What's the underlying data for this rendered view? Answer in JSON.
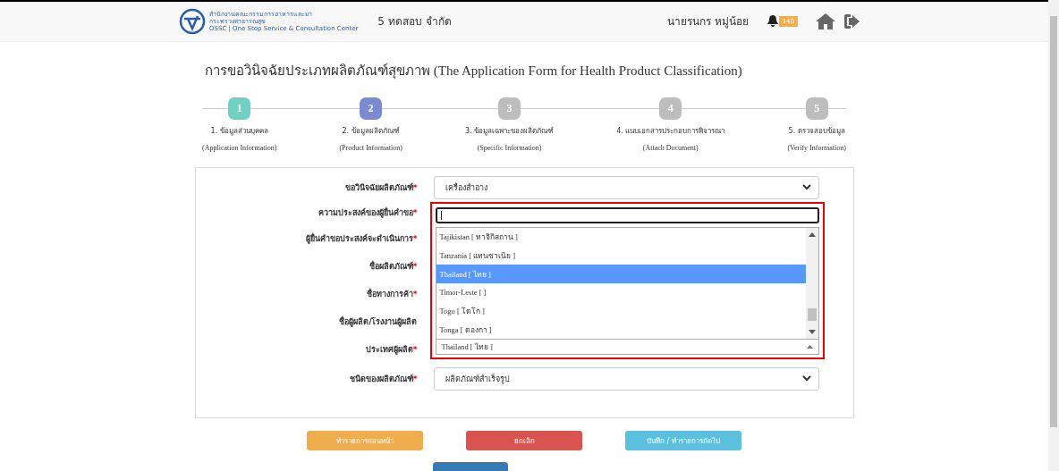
{
  "header": {
    "logo_lines": [
      "สำนักงานคณะกรรมการอาหารและยา",
      "กระทรวงสาธารณสุข",
      "OSSC | One Stop Service & Consultation Center"
    ],
    "company": "5 ทดสอบ จำกัด",
    "user": "นายรนกร หมู่น้อย",
    "notification_count": "140"
  },
  "title": {
    "thai": "การขอวินิจฉัยประเภทผลิตภัณฑ์สุขภาพ",
    "english": "(The Application Form for Health Product Classification)"
  },
  "steps": [
    {
      "number": "1",
      "label": "1. ข้อมูลส่วนบุคคล",
      "sublabel": "(Application Information)",
      "completed": true,
      "selected": false
    },
    {
      "number": "2",
      "label": "2. ข้อมูลผลิตภัณฑ์",
      "sublabel": "(Product Information)",
      "selected": true
    },
    {
      "number": "3",
      "label": "3. ข้อมูลเฉพาะของผลิตภัณฑ์",
      "sublabel": "(Specific Information)",
      "completed": false,
      "selected": false
    },
    {
      "number": "4",
      "label": "4. แนบเอกสารประกอบการพิจารณา",
      "sublabel": "(Attach Document)",
      "completed": false,
      "selected": false
    },
    {
      "number": "5",
      "label": "5. ตรวจสอบข้อมูล",
      "sublabel": "(Verify Information)",
      "completed": false,
      "selected": false
    }
  ],
  "form": {
    "fields": [
      {
        "label": "ขอวินิจฉัยผลิตภัณฑ์",
        "required_mark": "*",
        "value": "เครื่องสำอาง"
      },
      {
        "label": "ความประสงค์ของผู้ยื่นคำขอ",
        "required_mark": "*"
      },
      {
        "label": "ผู้ยื่นคำขอประสงค์จะดำเนินการ",
        "required_mark": "*"
      },
      {
        "label": "ชื่อผลิตภัณฑ์",
        "required_mark": "*"
      },
      {
        "label": "ชื่อทางการค้า",
        "required_mark": "*"
      },
      {
        "label": "ชื่อผู้ผลิต/โรงงานผู้ผลิต"
      },
      {
        "label": "ประเทศผู้ผลิต",
        "required_mark": "*",
        "value": "Thailand [ ไทย ]"
      },
      {
        "label": "ชนิดของผลิตภัณฑ์",
        "required_mark": "*",
        "value": "ผลิตภัณฑ์สำเร็จรูป"
      }
    ],
    "dropdown": {
      "options": [
        {
          "label": "Tajikistan [ ทาจิกิสถาน ]",
          "selected": false
        },
        {
          "label": "Tanzania [ แทนซาเนีย ]",
          "selected": false
        },
        {
          "label": "Thailand [ ไทย ]",
          "selected": true
        },
        {
          "label": "Timor-Leste [ ]",
          "selected": false
        },
        {
          "label": "Togo [ โตโก ]",
          "selected": false
        },
        {
          "label": "Tonga [ ตองกา ]",
          "selected": false
        }
      ]
    }
  },
  "buttons": [
    {
      "label": "ทำรายการก่อนหน้า",
      "kind": "warning"
    },
    {
      "label": "ยกเลิก",
      "kind": "danger"
    },
    {
      "label": "บันทึก / ทำรายการถัดไป",
      "kind": "info"
    }
  ]
}
